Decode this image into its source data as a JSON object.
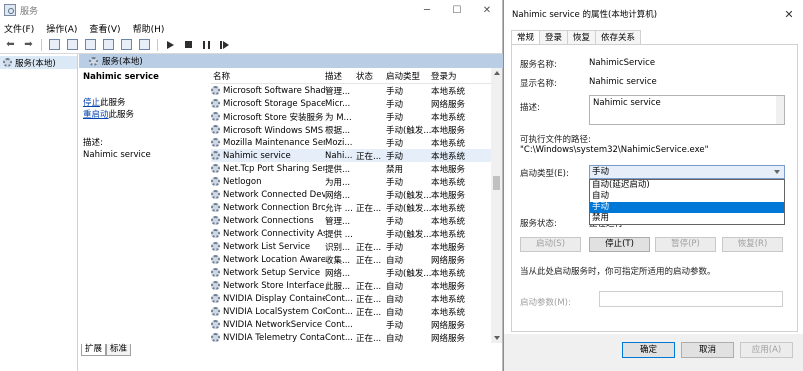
{
  "services_window": {
    "title": "服务",
    "menu": [
      "文件(F)",
      "操作(A)",
      "查看(V)",
      "帮助(H)"
    ],
    "tree_item": "服务(本地)",
    "content_header": "服务(本地)",
    "selected_service_name": "Nahimic service",
    "action_stop_prefix": "停止",
    "action_stop_suffix": "此服务",
    "action_restart_prefix": "重启动",
    "action_restart_suffix": "此服务",
    "desc_label": "描述:",
    "desc_value": "Nahimic service",
    "columns": {
      "name": "名称",
      "desc": "描述",
      "status": "状态",
      "startup": "启动类型",
      "logon": "登录为"
    },
    "rows": [
      {
        "name": "Microsoft Software Shado...",
        "desc": "管理...",
        "status": "",
        "startup": "手动",
        "logon": "本地系统"
      },
      {
        "name": "Microsoft Storage Spaces S...",
        "desc": "Micr...",
        "status": "",
        "startup": "手动",
        "logon": "网络服务"
      },
      {
        "name": "Microsoft Store 安装服务",
        "desc": "为 M...",
        "status": "",
        "startup": "手动",
        "logon": "本地系统"
      },
      {
        "name": "Microsoft Windows SMS 路...",
        "desc": "根据...",
        "status": "",
        "startup": "手动(触发...",
        "logon": "本地服务"
      },
      {
        "name": "Mozilla Maintenance Service",
        "desc": "Mozi...",
        "status": "",
        "startup": "手动",
        "logon": "本地系统"
      },
      {
        "name": "Nahimic service",
        "desc": "Nahi...",
        "status": "正在...",
        "startup": "手动",
        "logon": "本地系统"
      },
      {
        "name": "Net.Tcp Port Sharing Service",
        "desc": "提供...",
        "status": "",
        "startup": "禁用",
        "logon": "本地服务"
      },
      {
        "name": "Netlogon",
        "desc": "为用...",
        "status": "",
        "startup": "手动",
        "logon": "本地系统"
      },
      {
        "name": "Network Connected Devic...",
        "desc": "网络...",
        "status": "",
        "startup": "手动(触发...",
        "logon": "本地服务"
      },
      {
        "name": "Network Connection Broker",
        "desc": "允许 ...",
        "status": "正在...",
        "startup": "手动(触发...",
        "logon": "本地系统"
      },
      {
        "name": "Network Connections",
        "desc": "管理...",
        "status": "",
        "startup": "手动",
        "logon": "本地系统"
      },
      {
        "name": "Network Connectivity Assis...",
        "desc": "提供 ...",
        "status": "",
        "startup": "手动(触发...",
        "logon": "本地系统"
      },
      {
        "name": "Network List Service",
        "desc": "识别...",
        "status": "正在...",
        "startup": "手动",
        "logon": "本地服务"
      },
      {
        "name": "Network Location Awarene...",
        "desc": "收集...",
        "status": "正在...",
        "startup": "自动",
        "logon": "网络服务"
      },
      {
        "name": "Network Setup Service",
        "desc": "网络...",
        "status": "",
        "startup": "手动(触发...",
        "logon": "本地系统"
      },
      {
        "name": "Network Store Interface Se...",
        "desc": "此服...",
        "status": "正在...",
        "startup": "自动",
        "logon": "本地服务"
      },
      {
        "name": "NVIDIA Display Container LS",
        "desc": "Cont...",
        "status": "正在...",
        "startup": "自动",
        "logon": "本地系统"
      },
      {
        "name": "NVIDIA LocalSystem Conta...",
        "desc": "Cont...",
        "status": "正在...",
        "startup": "自动",
        "logon": "本地系统"
      },
      {
        "name": "NVIDIA NetworkService C...",
        "desc": "Cont...",
        "status": "",
        "startup": "手动",
        "logon": "网络服务"
      },
      {
        "name": "NVIDIA Telemetry Contain...",
        "desc": "Cont...",
        "status": "正在...",
        "startup": "自动",
        "logon": "网络服务"
      }
    ],
    "tabs": [
      "扩展",
      "标准"
    ]
  },
  "dialog": {
    "title": "Nahimic service 的属性(本地计算机)",
    "tabs": [
      "常规",
      "登录",
      "恢复",
      "依存关系"
    ],
    "service_name_label": "服务名称:",
    "service_name_value": "NahimicService",
    "display_name_label": "显示名称:",
    "display_name_value": "Nahimic service",
    "description_label": "描述:",
    "description_value": "Nahimic service",
    "exe_path_label": "可执行文件的路径:",
    "exe_path_value": "\"C:\\Windows\\system32\\NahimicService.exe\"",
    "startup_type_label": "启动类型(E):",
    "startup_type_value": "手动",
    "startup_options": [
      "自动(延迟启动)",
      "自动",
      "手动",
      "禁用"
    ],
    "startup_selected_index": 2,
    "service_status_label": "服务状态:",
    "service_status_value": "正在运行",
    "btn_start": "启动(S)",
    "btn_stop": "停止(T)",
    "btn_pause": "暂停(P)",
    "btn_resume": "恢复(R)",
    "hint": "当从此处启动服务时，你可指定所适用的启动参数。",
    "start_params_label": "启动参数(M):",
    "btn_ok": "确定",
    "btn_cancel": "取消",
    "btn_apply": "应用(A)"
  }
}
